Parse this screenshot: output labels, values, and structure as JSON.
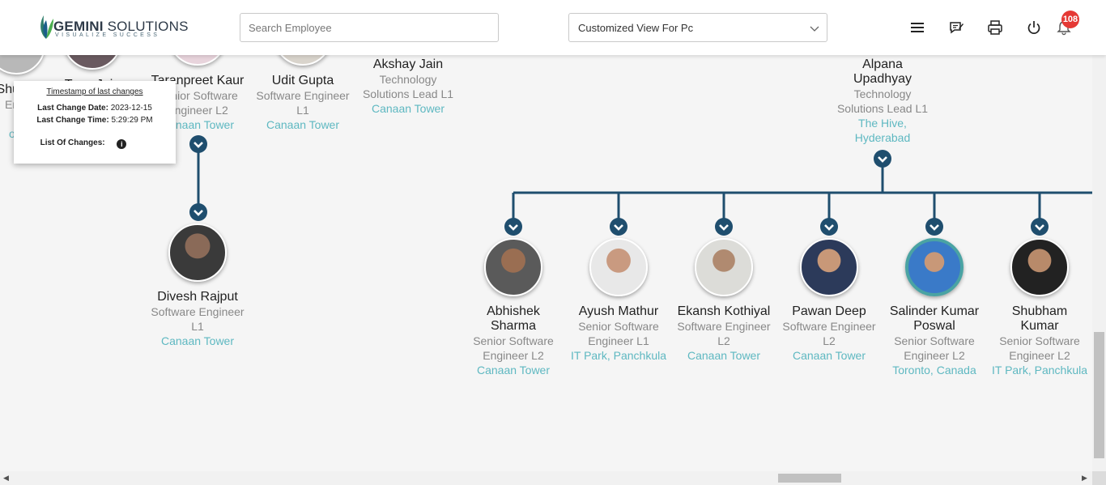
{
  "header": {
    "logo_brand": "GEMINI",
    "logo_rest": " SOLUTIONS",
    "logo_tagline": "VISUALIZE SUCCESS",
    "search_placeholder": "Search Employee",
    "view_select": "Customized View For Pc",
    "notification_count": "108",
    "icons": [
      "menu-icon",
      "feedback-icon",
      "print-icon",
      "power-icon",
      "bell-icon"
    ]
  },
  "tooltip": {
    "title": "Timestamp of last changes",
    "date_label": "Last Change Date:",
    "date_value": "2023-12-15",
    "time_label": "Last Change Time:",
    "time_value": "5:29:29 PM",
    "changes_label": "List Of Changes:"
  },
  "top_row": [
    {
      "name": "Shukla",
      "role": "Engi",
      "loc": "ow"
    },
    {
      "name": "Tanu Jain"
    },
    {
      "name": "Taranpreet Kaur",
      "role1": "Senior Software",
      "role2": "Engineer L2",
      "loc": "Canaan Tower"
    },
    {
      "name": "Udit Gupta",
      "role1": "Software Engineer",
      "role2": "L1",
      "loc": "Canaan Tower"
    },
    {
      "name": "Akshay Jain",
      "role1": "Technology",
      "role2": "Solutions Lead L1",
      "loc": "Canaan Tower"
    },
    {
      "name1": "Alpana",
      "name2": "Upadhyay",
      "role1": "Technology",
      "role2": "Solutions Lead L1",
      "loc1": "The Hive,",
      "loc2": "Hyderabad"
    }
  ],
  "divesh": {
    "name": "Divesh Rajput",
    "role1": "Software Engineer",
    "role2": "L1",
    "loc": "Canaan Tower"
  },
  "reports": [
    {
      "name1": "Abhishek",
      "name2": "Sharma",
      "role1": "Senior Software",
      "role2": "Engineer L2",
      "loc": "Canaan Tower"
    },
    {
      "name1": "Ayush Mathur",
      "role1": "Senior Software",
      "role2": "Engineer L1",
      "loc": "IT Park, Panchkula"
    },
    {
      "name1": "Ekansh Kothiyal",
      "role1": "Software Engineer",
      "role2": "L2",
      "loc": "Canaan Tower"
    },
    {
      "name1": "Pawan Deep",
      "role1": "Software Engineer",
      "role2": "L2",
      "loc": "Canaan Tower"
    },
    {
      "name1": "Salinder Kumar",
      "name2": "Poswal",
      "role1": "Senior Software",
      "role2": "Engineer L2",
      "loc": "Toronto, Canada"
    },
    {
      "name1": "Shubham",
      "name2": "Kumar",
      "role1": "Senior Software",
      "role2": "Engineer L2",
      "loc": "IT Park, Panchkula"
    }
  ],
  "colors": {
    "connector": "#1f4e6e",
    "location": "#5eb8c1",
    "badge": "#e53935"
  }
}
